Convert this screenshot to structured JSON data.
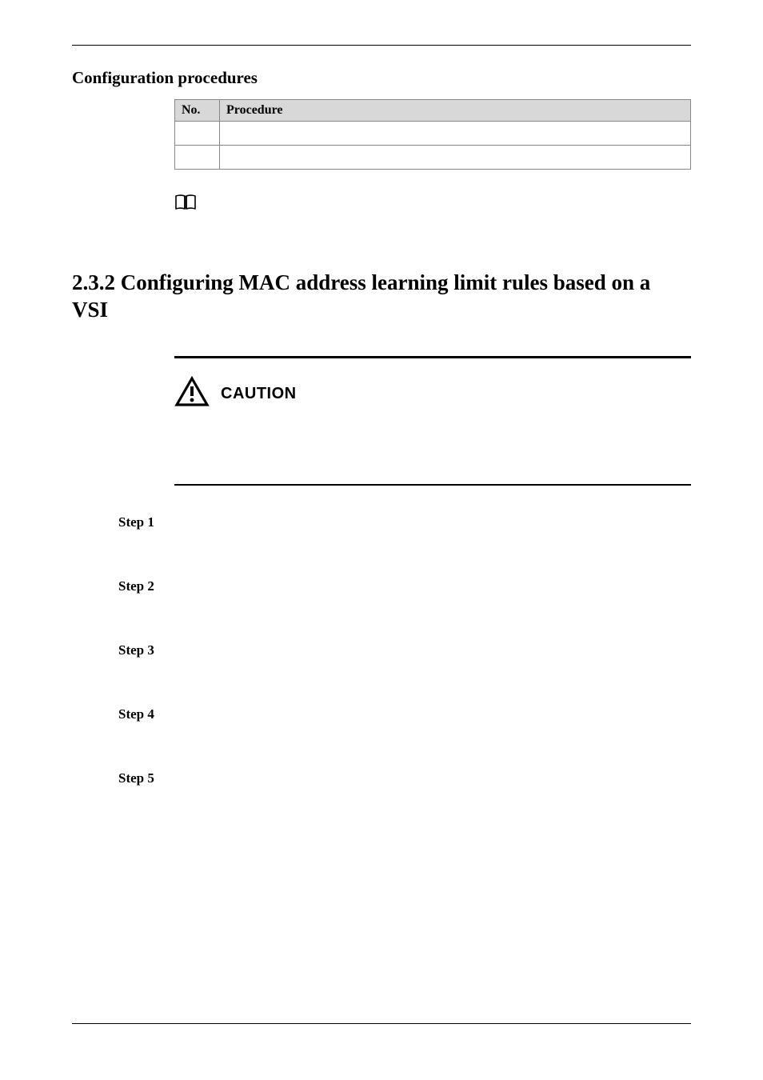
{
  "sectionLead": "Configuration procedures",
  "table": {
    "headers": {
      "no": "No.",
      "procedure": "Procedure"
    },
    "rows": [
      {
        "no": "",
        "procedure": ""
      },
      {
        "no": "",
        "procedure": ""
      }
    ]
  },
  "note": {
    "text": ""
  },
  "h2": "2.3.2 Configuring MAC address learning limit rules based on a VSI",
  "caution": {
    "label": "CAUTION",
    "body": ""
  },
  "steps": [
    {
      "label": "Step 1",
      "body": ""
    },
    {
      "label": "Step 2",
      "body": ""
    },
    {
      "label": "Step 3",
      "body": ""
    },
    {
      "label": "Step 4",
      "body": ""
    },
    {
      "label": "Step 5",
      "body": ""
    }
  ]
}
